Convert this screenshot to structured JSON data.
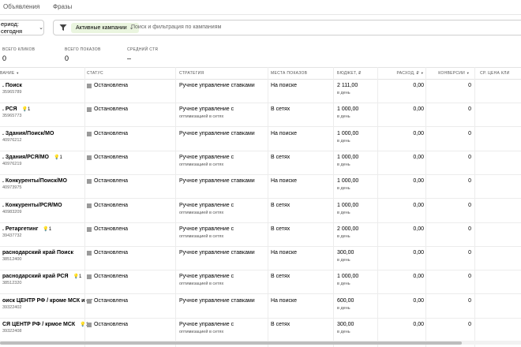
{
  "nav": {
    "tabs": [
      "Объявления",
      "Фразы"
    ]
  },
  "filter": {
    "period_label": "ериод: сегодня",
    "active_chip": "Активные кампании",
    "search_placeholder": "Поиск и фильтрация по кампаниям"
  },
  "stats": [
    {
      "label": "ВСЕГО КЛИКОВ",
      "value": "0"
    },
    {
      "label": "ВСЕГО ПОКАЗОВ",
      "value": "0"
    },
    {
      "label": "СРЕДНИЙ CTR",
      "value": "–"
    }
  ],
  "columns": [
    "ВАНИЕ",
    "СТАТУС",
    "СТРАТЕГИЯ",
    "МЕСТА ПОКАЗОВ",
    "БЮДЖЕТ, ₽",
    "РАСХОД, ₽",
    "КОНВЕРСИИ",
    "СР. ЦЕНА КЛИ"
  ],
  "sort_arrow": "▼",
  "per_day": "в день",
  "campaigns": [
    {
      "name": ". Поиск",
      "id": "35965789",
      "badge": "",
      "status": "Остановлена",
      "strategy": "Ручное управление ставками",
      "strategy_sub": "",
      "place": "На поиске",
      "budget": "2 111,00",
      "spend": "0,00",
      "conv": "0"
    },
    {
      "name": ". РСЯ",
      "id": "35965773",
      "badge": "1",
      "status": "Остановлена",
      "strategy": "Ручное управление с",
      "strategy_sub": "оптимизацией в сетях",
      "place": "В сетях",
      "budget": "1 000,00",
      "spend": "0,00",
      "conv": "0"
    },
    {
      "name": ". Здания/Поиск/МО",
      "id": "40976212",
      "badge": "",
      "status": "Остановлена",
      "strategy": "Ручное управление ставками",
      "strategy_sub": "",
      "place": "На поиске",
      "budget": "1 000,00",
      "spend": "0,00",
      "conv": "0"
    },
    {
      "name": ". Здания/РСЯ/МО",
      "id": "40976219",
      "badge": "1",
      "status": "Остановлена",
      "strategy": "Ручное управление с",
      "strategy_sub": "оптимизацией в сетях",
      "place": "В сетях",
      "budget": "1 000,00",
      "spend": "0,00",
      "conv": "0"
    },
    {
      "name": ". Конкуренты/Поиск/МО",
      "id": "40973975",
      "badge": "",
      "status": "Остановлена",
      "strategy": "Ручное управление ставками",
      "strategy_sub": "",
      "place": "На поиске",
      "budget": "1 000,00",
      "spend": "0,00",
      "conv": "0"
    },
    {
      "name": ". Конкуренты/РСЯ/МО",
      "id": "40983209",
      "badge": "",
      "status": "Остановлена",
      "strategy": "Ручное управление с",
      "strategy_sub": "оптимизацией в сетях",
      "place": "В сетях",
      "budget": "1 000,00",
      "spend": "0,00",
      "conv": "0"
    },
    {
      "name": ". Ретаргетинг",
      "id": "39437732",
      "badge": "1",
      "status": "Остановлена",
      "strategy": "Ручное управление с",
      "strategy_sub": "оптимизацией в сетях",
      "place": "В сетях",
      "budget": "2 000,00",
      "spend": "0,00",
      "conv": "0"
    },
    {
      "name": "раснодарский край Поиск",
      "id": "38512400",
      "badge": "",
      "status": "Остановлена",
      "strategy": "Ручное управление ставками",
      "strategy_sub": "",
      "place": "На поиске",
      "budget": "300,00",
      "spend": "0,00",
      "conv": "0"
    },
    {
      "name": "раснодарский край РСЯ",
      "id": "38512320",
      "badge": "1",
      "status": "Остановлена",
      "strategy": "Ручное управление с",
      "strategy_sub": "оптимизацией в сетях",
      "place": "В сетях",
      "budget": "1 000,00",
      "spend": "0,00",
      "conv": "0"
    },
    {
      "name": "оиск ЦЕНТР РФ / кроме МСК и от",
      "id": "39322402",
      "badge": "",
      "status": "Остановлена",
      "strategy": "Ручное управление ставками",
      "strategy_sub": "",
      "place": "На поиске",
      "budget": "600,00",
      "spend": "0,00",
      "conv": "0"
    },
    {
      "name": "СЯ ЦЕНТР РФ / крмое МСК",
      "id": "39322408",
      "badge": "1",
      "status": "Остановлена",
      "strategy": "Ручное управление с",
      "strategy_sub": "оптимизацией в сетях",
      "place": "В сетях",
      "budget": "300,00",
      "spend": "0,00",
      "conv": "0"
    }
  ]
}
